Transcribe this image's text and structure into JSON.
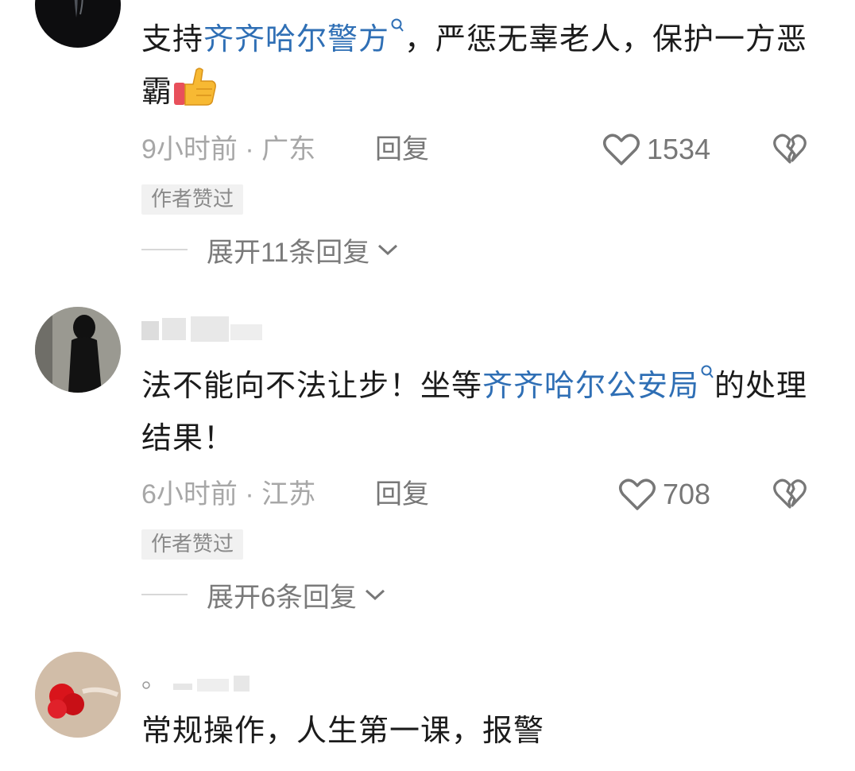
{
  "comments": [
    {
      "username": "",
      "content_pre": "支持",
      "topic": "齐齐哈尔警方",
      "content_post": "，严惩无辜老人，保护一方恶霸",
      "emoji": "thumbs-up-emoji",
      "time_location": "9小时前 · 广东",
      "reply_label": "回复",
      "like_count": "1534",
      "author_liked": "作者赞过",
      "expand_label": "展开11条回复"
    },
    {
      "username": "",
      "content_pre": "法不能向不法让步！坐等",
      "topic": "齐齐哈尔公安局",
      "content_post": "的处理结果！",
      "time_location": "6小时前 · 江苏",
      "reply_label": "回复",
      "like_count": "708",
      "author_liked": "作者赞过",
      "expand_label": "展开6条回复"
    },
    {
      "username": "",
      "content_pre": "常规操作，人生第一课，报警",
      "topic": "",
      "content_post": ""
    }
  ],
  "colors": {
    "topic_link": "#2f6fb5",
    "meta_text": "#a7a7a7",
    "badge_bg": "#f1f1f1"
  },
  "icons": [
    "heart-outline-icon",
    "broken-heart-icon",
    "chevron-down-icon",
    "search-icon",
    "thumbs-up-emoji"
  ]
}
